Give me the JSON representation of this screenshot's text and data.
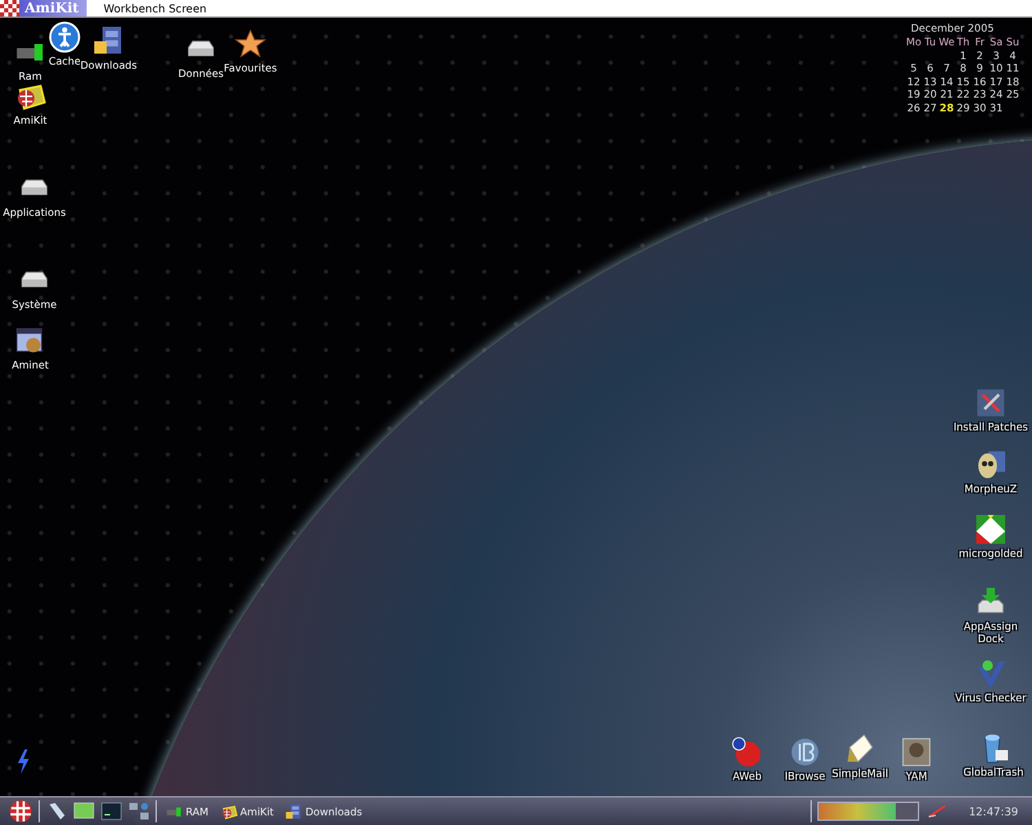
{
  "screen_bar": {
    "logo": "AmiKit",
    "title": "Workbench Screen"
  },
  "calendar": {
    "title": "December 2005",
    "weekdays": [
      "Mo",
      "Tu",
      "We",
      "Th",
      "Fr",
      "Sa",
      "Su"
    ],
    "weeks": [
      [
        {
          "d": "1",
          "today": false
        },
        {
          "d": "2",
          "today": false
        },
        {
          "d": "3",
          "today": false
        },
        {
          "d": "4",
          "today": false
        }
      ],
      [
        {
          "d": "5",
          "today": false
        },
        {
          "d": "6",
          "today": false
        },
        {
          "d": "7",
          "today": false
        },
        {
          "d": "8",
          "today": false
        },
        {
          "d": "9",
          "today": false
        },
        {
          "d": "10",
          "today": false
        },
        {
          "d": "11",
          "today": false
        }
      ],
      [
        {
          "d": "12",
          "today": false
        },
        {
          "d": "13",
          "today": false
        },
        {
          "d": "14",
          "today": false
        },
        {
          "d": "15",
          "today": false
        },
        {
          "d": "16",
          "today": false
        },
        {
          "d": "17",
          "today": false
        },
        {
          "d": "18",
          "today": false
        }
      ],
      [
        {
          "d": "19",
          "today": false
        },
        {
          "d": "20",
          "today": false
        },
        {
          "d": "21",
          "today": false
        },
        {
          "d": "22",
          "today": false
        },
        {
          "d": "23",
          "today": false
        },
        {
          "d": "24",
          "today": false
        },
        {
          "d": "25",
          "today": false
        }
      ],
      [
        {
          "d": "26",
          "today": false
        },
        {
          "d": "27",
          "today": false
        },
        {
          "d": "28",
          "today": true
        },
        {
          "d": "29",
          "today": false
        },
        {
          "d": "30",
          "today": false
        },
        {
          "d": "31",
          "today": false
        }
      ]
    ]
  },
  "icons_top": [
    {
      "label": "Ram",
      "kind": "ram"
    },
    {
      "label": "Cache",
      "kind": "info"
    },
    {
      "label": "Downloads",
      "kind": "cabinet"
    },
    {
      "label": "Données",
      "kind": "drive"
    },
    {
      "label": "Favourites",
      "kind": "star"
    },
    {
      "label": "AmiKit",
      "kind": "amikit"
    }
  ],
  "icons_left": [
    {
      "label": "Applications",
      "kind": "drive"
    },
    {
      "label": "Système",
      "kind": "drive"
    },
    {
      "label": "Aminet",
      "kind": "aminet"
    }
  ],
  "icons_right": [
    {
      "label": "Install Patches",
      "kind": "patches"
    },
    {
      "label": "MorpheuZ",
      "kind": "morpheuz"
    },
    {
      "label": "microgolded",
      "kind": "micro"
    },
    {
      "label": "AppAssign\nDock",
      "kind": "appassign"
    },
    {
      "label": "Virus Checker",
      "kind": "virus"
    },
    {
      "label": "GlobalTrash",
      "kind": "trash"
    }
  ],
  "icons_bottom": [
    {
      "label": "AWeb",
      "kind": "aweb"
    },
    {
      "label": "IBrowse",
      "kind": "ibrowse"
    },
    {
      "label": "SimpleMail",
      "kind": "mail"
    },
    {
      "label": "YAM",
      "kind": "yam"
    }
  ],
  "taskbar": {
    "tasks": [
      {
        "label": "RAM",
        "kind": "ram"
      },
      {
        "label": "AmiKit",
        "kind": "amikit"
      },
      {
        "label": "Downloads",
        "kind": "cabinet"
      }
    ],
    "memory_meter": {
      "level": 0.78
    },
    "clock": "12:47:39"
  }
}
